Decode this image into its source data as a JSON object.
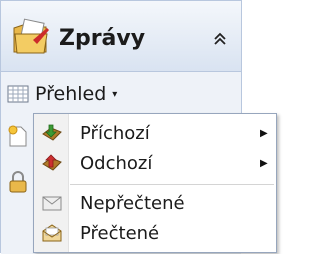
{
  "panel": {
    "title": "Zprávy",
    "header_icon": "mail-folder-icon",
    "collapse_icon": "double-chevron-up-icon"
  },
  "view": {
    "label": "Přehled",
    "icon": "grid-view-icon",
    "caret": "▾"
  },
  "side_icons": [
    "new-message-icon",
    "lock-icon"
  ],
  "menu": {
    "items": [
      {
        "label": "Příchozí",
        "icon": "inbox-icon",
        "submenu": true
      },
      {
        "label": "Odchozí",
        "icon": "outbox-icon",
        "submenu": true
      },
      {
        "label": "Nepřečtené",
        "icon": "unread-envelope-icon",
        "submenu": false
      },
      {
        "label": "Přečtené",
        "icon": "read-envelope-icon",
        "submenu": false
      }
    ],
    "submenu_arrow": "▶"
  },
  "colors": {
    "panel_bg": "#dfe7f3",
    "menu_bg": "#ffffff",
    "border": "#97a6bd"
  }
}
